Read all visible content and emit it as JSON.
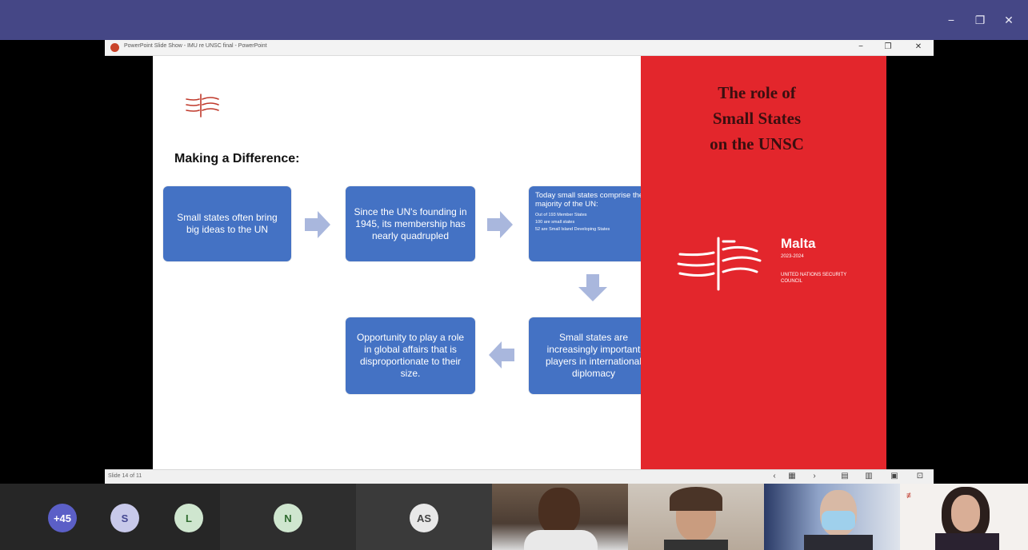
{
  "window": {
    "minimize_icon": "−",
    "maximize_icon": "❐",
    "close_icon": "✕"
  },
  "ppt": {
    "title": "PowerPoint Slide Show - IMU re UNSC final - PowerPoint",
    "status_counter": "Slide 14 of 11"
  },
  "slide": {
    "heading": "Making a Difference:",
    "box1": "Small states often bring big ideas to the UN",
    "box2": "Since the UN's founding in 1945, its membership has nearly quadrupled",
    "box3": {
      "head": "Today small states comprise the majority of the UN:",
      "lines": [
        "Out of 193 Member States",
        "100 are small states",
        "52 are Small Island Developing States"
      ]
    },
    "box4": "Small states are increasingly important players in international diplomacy",
    "box5": "Opportunity to play a role in global affairs that is disproportionate to their size.",
    "red_title_lines": [
      "The  role of",
      "Small States",
      "on the UNSC"
    ],
    "malta": {
      "name": "Malta",
      "years": "2023-2024",
      "council": "UNITED NATIONS SECURITY COUNCIL"
    }
  },
  "participants": {
    "overflow": "+45",
    "avatars": [
      "S",
      "L",
      "N",
      "AS"
    ]
  },
  "colors": {
    "teams_bar": "#454786",
    "slide_red": "#e3262c",
    "box_blue": "#4472c4",
    "arrow": "#a9b7dd"
  }
}
